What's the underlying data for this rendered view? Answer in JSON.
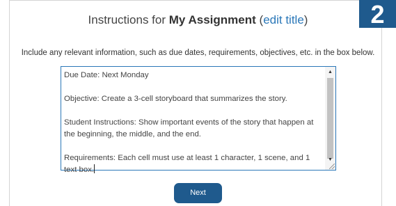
{
  "header": {
    "title_prefix": "Instructions for",
    "assignment_name": "My Assignment",
    "edit_link_label": "edit title",
    "paren_open": "(",
    "paren_close": ")",
    "step_number": "2"
  },
  "instruction_text": "Include any relevant information, such as due dates, requirements, objectives, etc. in the box below.",
  "textarea": {
    "paragraphs": [
      "Due Date: Next Monday",
      "Objective: Create a 3-cell storyboard that summarizes the story.",
      "Student Instructions: Show important events of the story that happen at the beginning, the middle, and the end.",
      "Requirements: Each cell must use at least 1 character, 1 scene, and 1 text box."
    ]
  },
  "footer": {
    "next_label": "Next"
  },
  "colors": {
    "accent": "#1f5a8d",
    "link": "#2a77b8",
    "border": "#d4d4d4"
  },
  "icons": {
    "scroll_up": "scroll-up-arrow",
    "scroll_down": "scroll-down-arrow",
    "resize": "resize-grip"
  }
}
